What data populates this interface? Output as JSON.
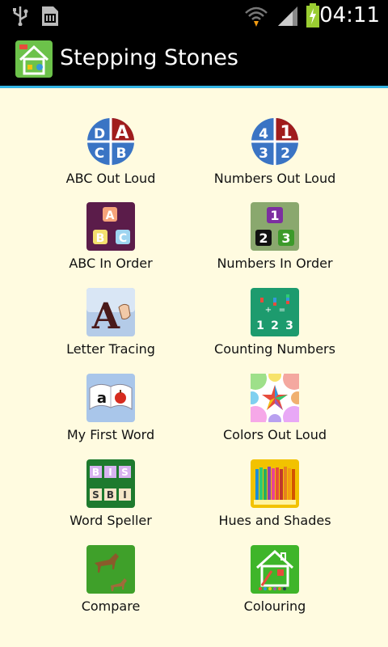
{
  "status_bar": {
    "time": "04:11",
    "icons": [
      "usb-icon",
      "sd-card-icon",
      "wifi-icon",
      "signal-icon",
      "battery-charging-icon"
    ]
  },
  "action_bar": {
    "title": "Stepping Stones",
    "icon": "house-app-icon"
  },
  "menu": {
    "items": [
      {
        "label": "ABC Out Loud",
        "icon": "abc-out-loud-icon"
      },
      {
        "label": "Numbers Out Loud",
        "icon": "numbers-out-loud-icon"
      },
      {
        "label": "ABC In Order",
        "icon": "abc-in-order-icon"
      },
      {
        "label": "Numbers In Order",
        "icon": "numbers-in-order-icon"
      },
      {
        "label": "Letter Tracing",
        "icon": "letter-tracing-icon"
      },
      {
        "label": "Counting Numbers",
        "icon": "counting-numbers-icon"
      },
      {
        "label": "My First Word",
        "icon": "my-first-word-icon"
      },
      {
        "label": "Colors Out Loud",
        "icon": "colors-out-loud-icon"
      },
      {
        "label": "Word Speller",
        "icon": "word-speller-icon"
      },
      {
        "label": "Hues and Shades",
        "icon": "hues-and-shades-icon"
      },
      {
        "label": "Compare",
        "icon": "compare-icon"
      },
      {
        "label": "Colouring",
        "icon": "colouring-icon"
      }
    ]
  },
  "tile_letters": {
    "abc_out_loud": [
      "D",
      "A",
      "C",
      "B"
    ],
    "numbers_out_loud": [
      "4",
      "1",
      "3",
      "2"
    ],
    "abc_in_order": [
      "A",
      "B",
      "C"
    ],
    "numbers_in_order": [
      "1",
      "2",
      "3"
    ],
    "letter_tracing": "A",
    "counting_numbers": [
      "+",
      "=",
      "1",
      "2",
      "3"
    ],
    "my_first_word": "a",
    "word_speller_top": [
      "B",
      "I",
      "S"
    ],
    "word_speller_bottom": [
      "S",
      "B",
      "I"
    ]
  },
  "colors": {
    "accent": "#33b5e5",
    "background": "#fffbe0",
    "bar": "#000000"
  }
}
